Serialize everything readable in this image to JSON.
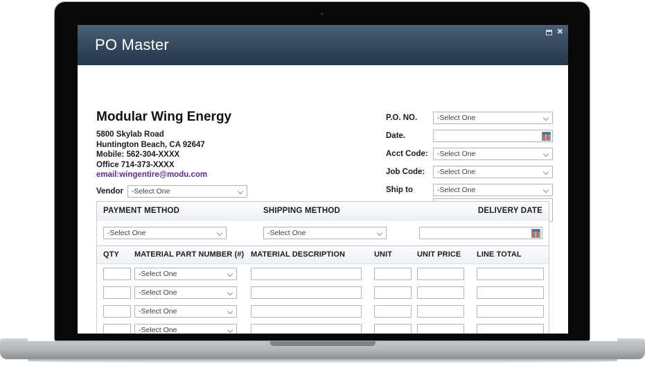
{
  "window": {
    "title": "PO Master",
    "controls": [
      {
        "name": "restore-button",
        "glyph": ""
      },
      {
        "name": "close-button",
        "glyph": "✖"
      }
    ]
  },
  "company": {
    "name": "Modular Wing Energy",
    "address_line1": "5800 Skylab Road",
    "address_line2": "Huntington Beach, CA 92647",
    "mobile": "Mobile: 562-304-XXXX",
    "office": "Office 714-373-XXXX",
    "email": "email:wingentire@modu.com",
    "email_color": "#5b2d8e"
  },
  "vendor": {
    "label": "Vendor",
    "select_value": "-Select One"
  },
  "order_fields": [
    {
      "label": "P.O. NO.",
      "type": "select",
      "value": "-Select One"
    },
    {
      "label": "Date.",
      "type": "date",
      "value": ""
    },
    {
      "label": "Acct Code:",
      "type": "select",
      "value": "-Select One"
    },
    {
      "label": "Job Code:",
      "type": "select",
      "value": "-Select One"
    },
    {
      "label": "Ship to",
      "type": "select",
      "value": "-Select One"
    }
  ],
  "band": {
    "payment_header": "PAYMENT METHOD",
    "shipping_header": "SHIPPING METHOD",
    "delivery_header": "DELIVERY DATE",
    "payment_value": "-Select One",
    "shipping_value": "-Select One",
    "delivery_value": ""
  },
  "items_table": {
    "columns": [
      "QTY",
      "MATERIAL PART NUMBER (#)",
      "MATERIAL DESCRIPTION",
      "UNIT",
      "UNIT PRICE",
      "LINE TOTAL"
    ],
    "rows": [
      {
        "qty": "",
        "part": "-Select One",
        "description": "",
        "unit": "",
        "unit_price": "",
        "line_total": ""
      },
      {
        "qty": "",
        "part": "-Select One",
        "description": "",
        "unit": "",
        "unit_price": "",
        "line_total": ""
      },
      {
        "qty": "",
        "part": "-Select One",
        "description": "",
        "unit": "",
        "unit_price": "",
        "line_total": ""
      },
      {
        "qty": "",
        "part": "-Select One",
        "description": "",
        "unit": "",
        "unit_price": "",
        "line_total": ""
      }
    ]
  },
  "theme": {
    "titlebar_top": "#4a6076",
    "titlebar_bottom": "#25374a",
    "field_border": "#b4b4b4",
    "band_bg": "#f4f6f9"
  }
}
